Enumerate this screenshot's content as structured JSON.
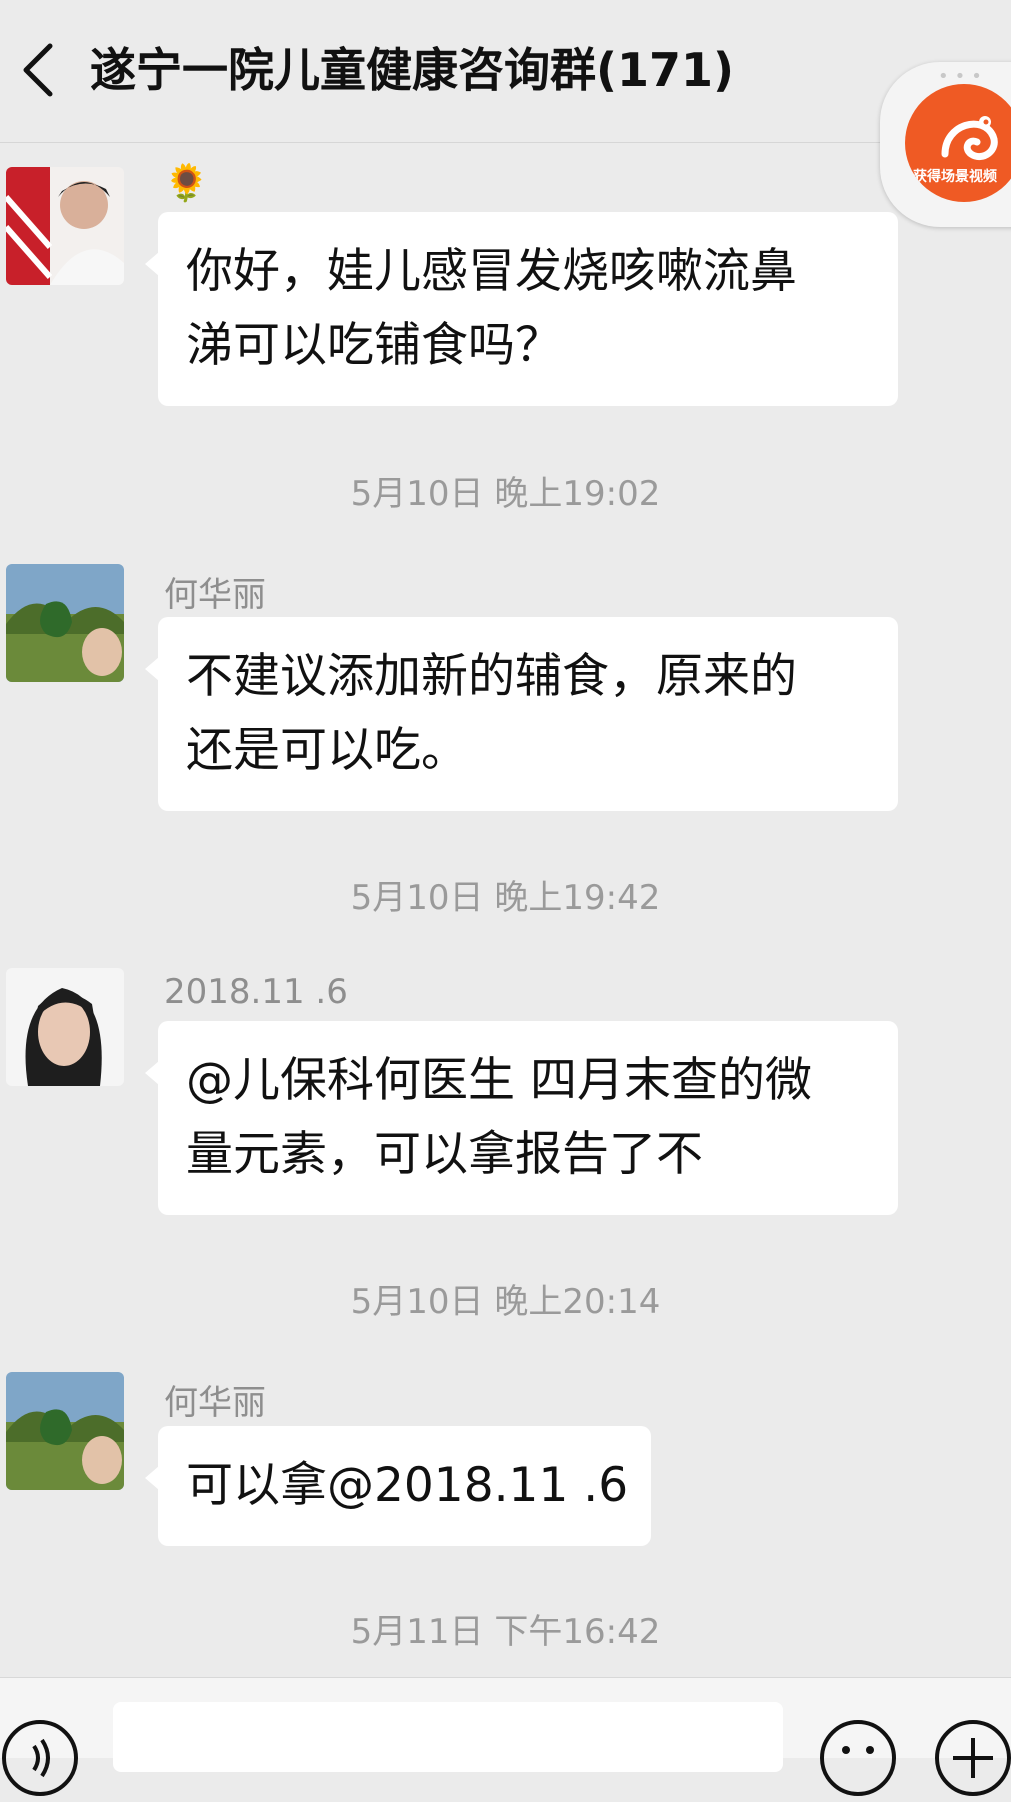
{
  "header": {
    "title": "遂宁一院儿童健康咨询群(171)"
  },
  "floating_widget": {
    "label": "获得场景视频",
    "accent": "#ef5a24"
  },
  "messages": [
    {
      "sender": "🌻",
      "lines": [
        "你好，娃儿感冒发烧咳嗽流鼻",
        "涕可以吃铺食吗？"
      ]
    },
    {
      "sender": "何华丽",
      "lines": [
        "不建议添加新的辅食，原来的",
        "还是可以吃。"
      ]
    },
    {
      "sender": "2018.11 .6",
      "lines": [
        "@儿保科何医生  四月末查的微",
        "量元素，可以拿报告了不"
      ]
    },
    {
      "sender": "何华丽",
      "lines": [
        "可以拿@2018.11 .6"
      ]
    }
  ],
  "timestamps": [
    "5月10日 晚上19:02",
    "5月10日 晚上19:42",
    "5月10日 晚上20:14",
    "5月11日 下午16:42"
  ],
  "input": {
    "value": "",
    "placeholder": ""
  },
  "icons": {
    "back": "chevron-left-icon",
    "voice": "voice-icon",
    "emoji": "emoji-icon",
    "plus": "plus-icon"
  }
}
